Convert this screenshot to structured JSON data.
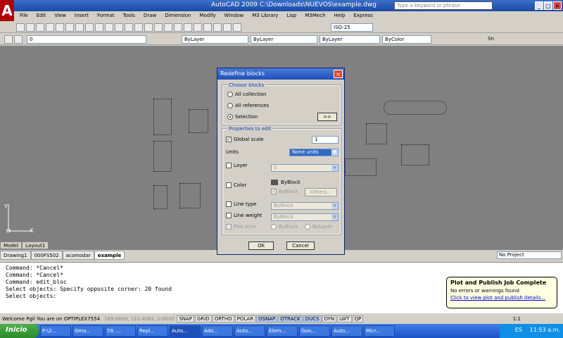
{
  "window": {
    "title": "AutoCAD 2009  C:\\Downloads\\NUEVOS\\example.dwg",
    "search_placeholder": "Type a keyword or phrase",
    "btn_min": "_",
    "btn_max": "□",
    "btn_close": "×"
  },
  "menu": [
    "File",
    "Edit",
    "View",
    "Insert",
    "Format",
    "Tools",
    "Draw",
    "Dimension",
    "Modify",
    "Window",
    "M3 Library",
    "Lisp",
    "M3Mech",
    "Help",
    "Express"
  ],
  "toolbar": {
    "dimstyle": "ISO-25",
    "layer": "0",
    "color": "ByLayer",
    "linetype": "ByLayer",
    "lineweight": "ByLayer",
    "plotstyle": "ByColor",
    "snap_label": "Sn"
  },
  "layout_tabs": [
    "Model",
    "Layout1"
  ],
  "file_tabs": [
    "Drawing1",
    "000FS502",
    "acomodar",
    "example"
  ],
  "project": "No Project",
  "command_lines": [
    "Command: *Cancel*",
    "Command: *Cancel*",
    "Command: edit_bloc",
    "Select objects: Specify opposite corner: 20 found",
    "Select objects:"
  ],
  "status": {
    "welcome": "Welcome Pgil You are on OPTIPLEX7554",
    "coords": "189.6609, 110.4062, 0.0000",
    "buttons": [
      "SNAP",
      "GRID",
      "ORTHO",
      "POLAR",
      "OSNAP",
      "OTRACK",
      "DUCS",
      "DYN",
      "LWT",
      "QP"
    ],
    "on_buttons": [
      "OSNAP",
      "OTRACK",
      "DUCS"
    ],
    "scale": "1:1"
  },
  "taskbar": {
    "start": "Inicio",
    "tasks": [
      "P:\\2...",
      "Gma...",
      "59. ...",
      "Repl...",
      "Auto...",
      "Ado...",
      "Auto...",
      "Elem...",
      "Goo...",
      "Auto...",
      "Micr..."
    ],
    "lang": "ES",
    "clock": "11:53 a.m."
  },
  "balloon": {
    "title": "Plot and Publish Job Complete",
    "line1": "No errors or warnings found",
    "link": "Click to view plot and publish details..."
  },
  "dialog": {
    "title": "Redefine blocks",
    "choose_group": "Choose blocks",
    "radios": [
      "All collection",
      "All references",
      "Selection"
    ],
    "pick_btn": ">>",
    "props_group": "Properties to edit",
    "global_scale_label": "Global scale",
    "global_scale_value": "1",
    "units_label": "Units",
    "units_value": "None units",
    "layer_label": "Layer",
    "layer_value": "0",
    "color_label": "Color",
    "color_value": "ByBlock",
    "color_byblock": "ByBlock",
    "others_btn": "Others...",
    "linetype_label": "Line type",
    "linetype_value": "ByBlock",
    "lineweight_label": "Line weight",
    "lineweight_value": "ByBlock",
    "plotstyle_label": "Plot style",
    "plot_byblock": "ByBlock",
    "plot_bylayer": "ByLayer",
    "ok": "OK",
    "cancel": "Cancel"
  },
  "ucs": {
    "x": "X",
    "y": "Y"
  }
}
